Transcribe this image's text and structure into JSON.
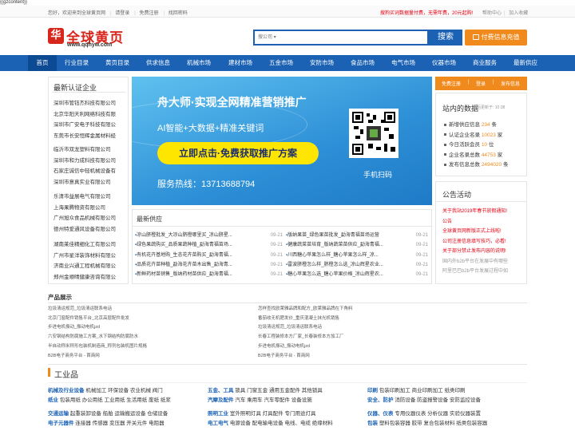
{
  "raw_template": "{{gzcontent}}",
  "topbar": {
    "welcome": "您好，欢迎来到全球黄页网",
    "login": "请登录",
    "register": "免费注册",
    "forgot": "找回密码",
    "promo": "搜狗买词数据量付费，无需年费，20元起购!",
    "help": "帮助中心",
    "fav": "加入收藏"
  },
  "logo": {
    "seal": "华",
    "cn": "全球黄页",
    "url": "www.qqhyw.com"
  },
  "search": {
    "placeholder": "搜公司 ▾",
    "button": "搜索"
  },
  "pay_button": "付费信息充值",
  "nav": [
    "首页",
    "行业目录",
    "黄页目录",
    "供求信息",
    "机械市场",
    "建材市场",
    "五金市场",
    "安防市场",
    "食品市场",
    "电气市场",
    "仪器市场",
    "商业服务",
    "最新供应"
  ],
  "latest_companies": {
    "title": "最新认证企业",
    "items": [
      "深圳市管钰杰科技有限公司",
      "北京华阳天利网络科技有限",
      "深圳市广安电子科技有限公",
      "东莞市长安恒辉金属材料经",
      "临沂市双龙塑料有限公司",
      "深圳市和力成科技有限公司",
      "石家庄诚信中轻机械设备有",
      "深圳市意真实业有限公司",
      "乐清市益展电气有限公司",
      "上海果腾物资有限公司",
      "广州旭众食品机械有限公司",
      "德州特爱通风设备有限公司",
      "湖南莱佳精细化工有限公司",
      "广州市星洋装饰材料有限公",
      "济南业兴通工程机械有限公",
      "郑州金顺晴健康咨询有限公"
    ]
  },
  "banner": {
    "title": "舟大师·实现全网精准营销推广",
    "sub": "AI智能+大数据+精准关键词",
    "cta": "立即点击·免费获取推广方案",
    "hotline": "服务热线：13713688794",
    "scan": "手机扫码"
  },
  "latest_supply": {
    "title": "最新供应",
    "left": [
      {
        "t": "凉山脐橙批发_大凉山脐橙哪里买_凉山脐星...",
        "d": "09-21"
      },
      {
        "t": "绿色果蔬购买_品质果蔬种植_勐海青福苗场...",
        "d": "09-21"
      },
      {
        "t": "有机花卉基地购_生态花卉苗购买_勐海青福...",
        "d": "09-21"
      },
      {
        "t": "品质花卉苗种植_勐海花卉苗木出售_勐海青...",
        "d": "09-21"
      },
      {
        "t": "新鲜药材苗销售_版纳药材苗供应_勐海青福...",
        "d": "09-21"
      }
    ],
    "right": [
      {
        "t": "版纳果苗_绿色果苗批发_勐海青福苗场运营",
        "d": "09-21"
      },
      {
        "t": "健康蔬菜苗培育_版纳蔬菜苗供应_勐海青福...",
        "d": "09-21"
      },
      {
        "t": "川西糖心苹果怎么样_糖心苹果怎么样_凉...",
        "d": "09-21"
      },
      {
        "t": "雷波脐橙怎么样_脐橙怎么选_凉山辉星农业...",
        "d": "09-21"
      },
      {
        "t": "糖心苹果怎么选_糖心苹果价格_凉山辉星农...",
        "d": "09-21"
      }
    ]
  },
  "user_bar": {
    "free": "免费注册",
    "login": "登录",
    "publish": "发布信息"
  },
  "stats": {
    "title": "站内的数据",
    "updated": "最后更新于: 10:38",
    "rows": [
      {
        "l": "新增供应信息",
        "v": "234",
        "u": "条"
      },
      {
        "l": "认证企业名录",
        "v": "10023",
        "u": "家"
      },
      {
        "l": "今日活跃会员",
        "v": "10",
        "u": "位"
      },
      {
        "l": "企业名录总数",
        "v": "44753",
        "u": "家"
      },
      {
        "l": "发布信息总数",
        "v": "2494020",
        "u": "条"
      }
    ]
  },
  "notice": {
    "title": "公告活动",
    "items": [
      "关于我站2019年春节放假通知!",
      "公告",
      "全球黄页网新版正式上线啦!",
      "公司注册信息填写技巧，必看!",
      "关于部分禁止发布内容的说明!",
      "国内外b2b平台在发展中有哪些",
      "阿里巴巴b2b平台发展过程中如"
    ]
  },
  "products": {
    "title": "产品展示",
    "left": [
      "垃圾清运规范_垃圾清运联系电话",
      "北京门窗配件销售平台_北京高层配件批发",
      "步进电机振动_振动电机jzd",
      "六安钢结构防腐施工方案_水下钢结构防腐防水",
      "半自动称米秤形包装机制造商_称剂包装机图片规格",
      "B2B电子商务平台 - 首商网"
    ],
    "right": [
      "怎样查找欧莱雅品牌和配方_欧莱雅品牌在下角料",
      "番茄收无机肥发价_重庆混凝土抹光机销售",
      "垃圾清运规范_垃圾清运联系电话",
      "长春工程装修本方厂家_长春装修本方加工厂",
      "步进电机振动_振动电机jzd",
      "B2B电子商务平台 - 首商网"
    ]
  },
  "industry": {
    "title": "工业品",
    "cols": [
      [
        {
          "h": "机械及行业设备",
          "items": [
            "机械加工",
            "环保设备",
            "农业机械",
            "阀门"
          ]
        },
        {
          "h": "纸业",
          "items": [
            "包装用纸",
            "办公用纸",
            "工业用纸",
            "生活用纸",
            "废纸",
            "纸浆"
          ]
        },
        {
          "h": "交通运输",
          "items": [
            "船舶",
            "起重装卸设备",
            "船舶",
            "运输搬运设备",
            "仓储设备"
          ]
        },
        {
          "h": "电子元器件",
          "items": [
            "连接器",
            "传感器",
            "变压器",
            "开关元件",
            "电阻器"
          ]
        }
      ],
      [
        {
          "h": "五金、工具",
          "items": [
            "锁具",
            "门窗五金",
            "通用五金配件",
            "其他锁具"
          ]
        },
        {
          "h": "汽摩及配件",
          "items": [
            "汽车",
            "乘用车",
            "汽车零配件",
            "设备设施"
          ]
        },
        {
          "h": "照明工业",
          "items": [
            "室外照明灯具",
            "灯具配件",
            "专门用途灯具"
          ]
        },
        {
          "h": "电工电气",
          "items": [
            "电源设备",
            "配电输电设备",
            "电线、电缆",
            "绝缘材料"
          ]
        }
      ],
      [
        {
          "h": "印刷",
          "items": [
            "包装印刷加工",
            "商业印刷加工",
            "纸类印刷"
          ]
        },
        {
          "h": "安全、防护",
          "items": [
            "消防设备",
            "防盗报警设备",
            "安防监控设备"
          ]
        },
        {
          "h": "仪器、仪表",
          "items": [
            "专用仪器仪表",
            "分析仪器",
            "实验仪器装置"
          ]
        },
        {
          "h": "包装",
          "items": [
            "塑料包装容器",
            "胶带",
            "复合包装材料",
            "纸类包装容器"
          ]
        }
      ]
    ]
  }
}
